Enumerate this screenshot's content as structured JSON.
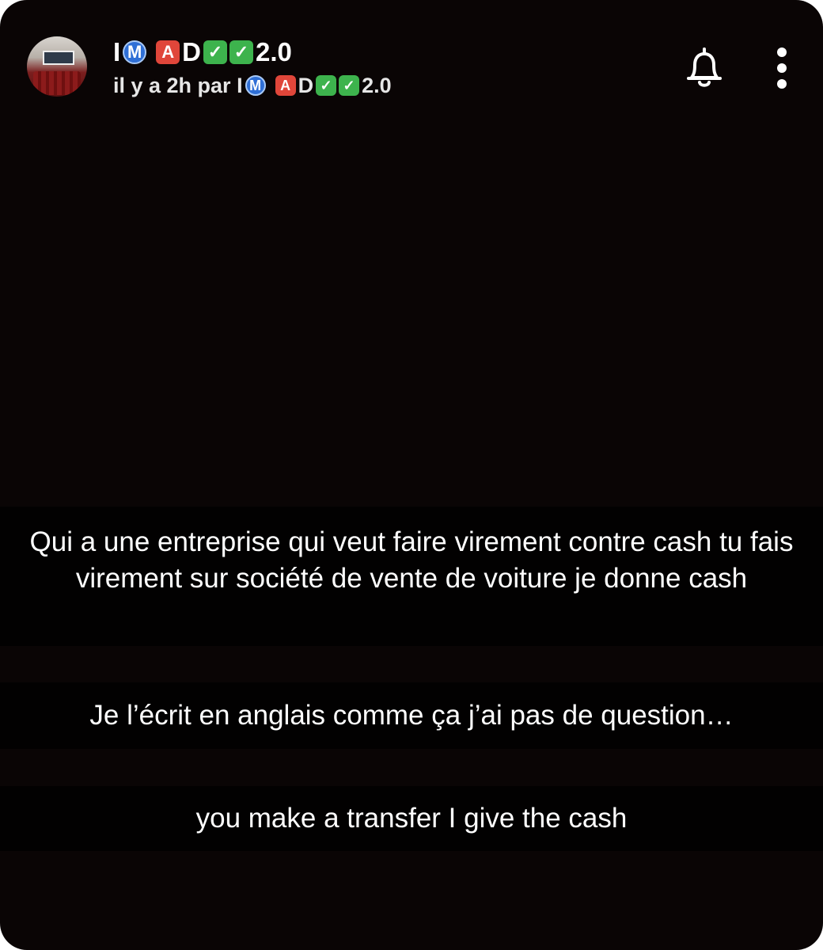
{
  "header": {
    "avatar_alt": "profile picture",
    "name": {
      "p1": "I",
      "b1": "M",
      "b2": "A",
      "p2": "D",
      "b3": "✓",
      "b4": "✓",
      "p3": "2.0"
    },
    "subtitle": {
      "prefix": "il y a 2h par I",
      "b1": "M",
      "b2": "A",
      "p2": "D",
      "b3": "✓",
      "b4": "✓",
      "p3": "2.0"
    },
    "icons": {
      "notification": "bell-icon",
      "menu": "more-vertical-icon"
    }
  },
  "captions": [
    {
      "text": "Qui a une entreprise qui veut faire virement contre cash tu fais virement sur société de vente de voiture je donne cash"
    },
    {
      "text": "Je l’écrit en anglais comme ça j’ai pas de question…"
    },
    {
      "text": "you make a transfer I give the cash"
    }
  ],
  "colors": {
    "background": "#0a0505",
    "caption_bar": "rgba(0,0,0,0.72)",
    "text": "#ffffff",
    "badge_blue": "#2f6fd6",
    "badge_red": "#e0463a",
    "badge_green": "#3db34d"
  }
}
